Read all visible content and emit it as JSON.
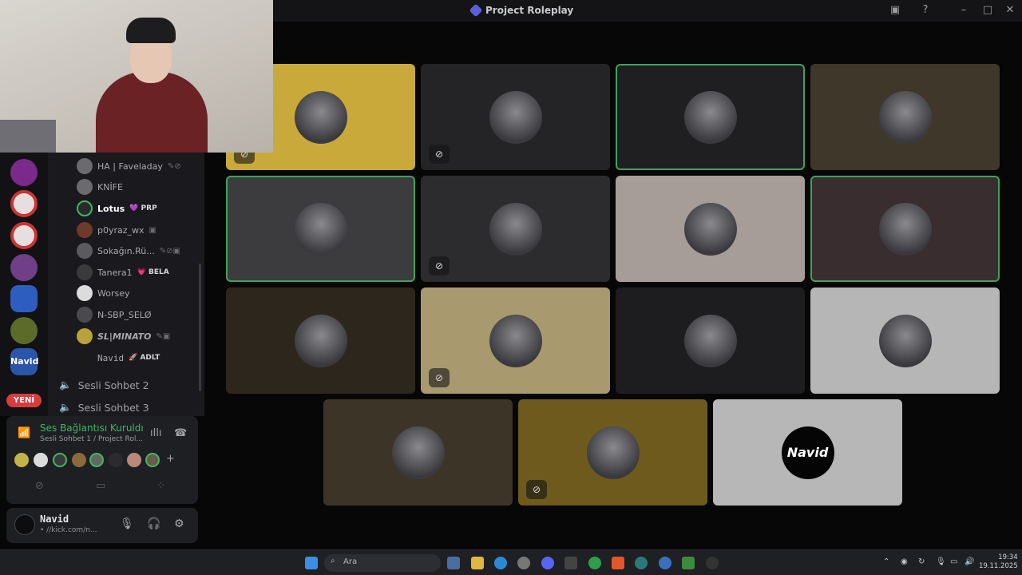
{
  "window": {
    "title": "Project Roleplay"
  },
  "members": [
    {
      "name": "HA | Faveladay",
      "tag": "",
      "icons": "✎⊘"
    },
    {
      "name": "KNİFE",
      "tag": "",
      "icons": ""
    },
    {
      "name": "Lotus",
      "tag": "💜 PRP",
      "icons": ""
    },
    {
      "name": "p0yraz_wx",
      "tag": "",
      "icons": "▣"
    },
    {
      "name": "Sokağın.Rü...",
      "tag": "",
      "icons": "✎⊘▣"
    },
    {
      "name": "Tanera1",
      "tag": "💗 BELA",
      "icons": ""
    },
    {
      "name": "Worsey",
      "tag": "",
      "icons": ""
    },
    {
      "name": "N-SBP_SELØ",
      "tag": "",
      "icons": ""
    },
    {
      "name": "SL|MINATO",
      "tag": "",
      "icons": "✎▣"
    },
    {
      "name": "Navid",
      "tag": "🚀 ADLT",
      "icons": ""
    }
  ],
  "voice_channels": [
    "Sesli Sohbet 2",
    "Sesli Sohbet 3"
  ],
  "rail": {
    "new_badge": "YENİ",
    "navid_label": "Navid"
  },
  "voice_panel": {
    "status": "Ses Bağlantısı Kuruldı",
    "subtitle": "Sesli Sohbet 1 / Project Rol..."
  },
  "user": {
    "name": "Navid",
    "status": "• //kick.com/n..."
  },
  "video_tiles": [
    {
      "id": 1,
      "color": "#c9a93a",
      "speaking": false,
      "muted": true
    },
    {
      "id": 2,
      "color": "#242426",
      "speaking": false,
      "muted": true
    },
    {
      "id": 3,
      "color": "#1f1f21",
      "speaking": true,
      "muted": false
    },
    {
      "id": 4,
      "color": "#3f372a",
      "speaking": false,
      "muted": false
    },
    {
      "id": 5,
      "color": "#3c3c3e",
      "speaking": true,
      "muted": false
    },
    {
      "id": 6,
      "color": "#2c2c2e",
      "speaking": false,
      "muted": true
    },
    {
      "id": 7,
      "color": "#a69d98",
      "speaking": false,
      "muted": false
    },
    {
      "id": 8,
      "color": "#3a2d2f",
      "speaking": true,
      "muted": false
    },
    {
      "id": 9,
      "color": "#2c261d",
      "speaking": false,
      "muted": false
    },
    {
      "id": 10,
      "color": "#a8996f",
      "speaking": false,
      "muted": true
    },
    {
      "id": 11,
      "color": "#1d1d1f",
      "speaking": false,
      "muted": false
    },
    {
      "id": 12,
      "color": "#b6b6b6",
      "speaking": false,
      "muted": false
    },
    {
      "id": 13,
      "color": "#3c3426",
      "speaking": false,
      "muted": false
    },
    {
      "id": 14,
      "color": "#6d5a1c",
      "speaking": false,
      "muted": true
    },
    {
      "id": 15,
      "color": "#b7b7b7",
      "speaking": false,
      "muted": false,
      "label": "Navid"
    }
  ],
  "taskbar": {
    "search_placeholder": "Ara",
    "time": "19:34",
    "date": "19.11.2025"
  }
}
